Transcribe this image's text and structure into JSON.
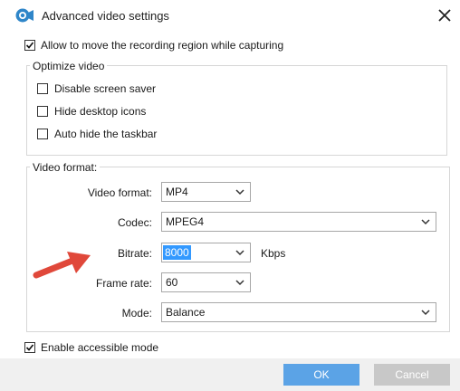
{
  "window": {
    "title": "Advanced video settings",
    "close_icon": "close-icon",
    "app_icon": "video-camera-icon"
  },
  "allow_move": {
    "label": "Allow to move the recording region while capturing",
    "checked": true
  },
  "optimize": {
    "legend": "Optimize video",
    "items": [
      {
        "label": "Disable screen saver",
        "checked": false
      },
      {
        "label": "Hide desktop icons",
        "checked": false
      },
      {
        "label": "Auto hide the taskbar",
        "checked": false
      }
    ]
  },
  "format": {
    "legend": "Video format:",
    "video_format": {
      "label": "Video format:",
      "value": "MP4"
    },
    "codec": {
      "label": "Codec:",
      "value": "MPEG4"
    },
    "bitrate": {
      "label": "Bitrate:",
      "value": "8000",
      "unit": "Kbps"
    },
    "frame_rate": {
      "label": "Frame rate:",
      "value": "60"
    },
    "mode": {
      "label": "Mode:",
      "value": "Balance"
    }
  },
  "accessible": {
    "label": "Enable accessible mode",
    "checked": true
  },
  "buttons": {
    "ok": "OK",
    "cancel": "Cancel"
  },
  "colors": {
    "ok_bg": "#5ba3e6",
    "cancel_bg": "#c8c8c8",
    "accent_arrow": "#e0483a",
    "footer_bg": "#f0f0f0"
  }
}
